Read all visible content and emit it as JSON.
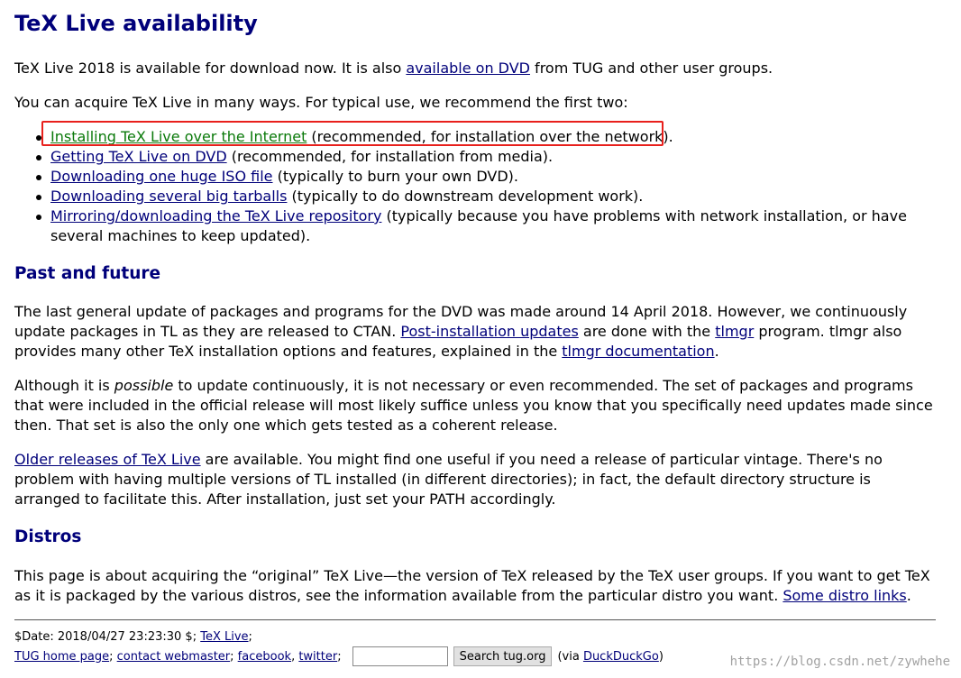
{
  "title": "TeX Live availability",
  "intro": {
    "text_before": "TeX Live 2018 is available for download now. It is also ",
    "dvd_link": "available on DVD",
    "text_after": " from TUG and other user groups."
  },
  "acquire_text": "You can acquire TeX Live in many ways. For typical use, we recommend the first two:",
  "ways": [
    {
      "link": "Installing TeX Live over the Internet",
      "desc": " (recommended, for installation over the network)."
    },
    {
      "link": "Getting TeX Live on DVD",
      "desc": " (recommended, for installation from media)."
    },
    {
      "link": "Downloading one huge ISO file",
      "desc": " (typically to burn your own DVD)."
    },
    {
      "link": "Downloading several big tarballs",
      "desc": " (typically to do downstream development work)."
    },
    {
      "link": "Mirroring/downloading the TeX Live repository",
      "desc": " (typically because you have problems with network installation, or have several machines to keep updated)."
    }
  ],
  "past_future": {
    "heading": "Past and future",
    "p1_a": "The last general update of packages and programs for the DVD was made around 14 April 2018. However, we continuously update packages in TL as they are released to CTAN. ",
    "p1_link1": "Post-installation updates",
    "p1_b": " are done with the ",
    "p1_link2": "tlmgr",
    "p1_c": " program. tlmgr also provides many other TeX installation options and features, explained in the ",
    "p1_link3": "tlmgr documentation",
    "p1_d": ".",
    "p2_a": "Although it is ",
    "p2_em": "possible",
    "p2_b": " to update continuously, it is not necessary or even recommended. The set of packages and programs that were included in the official release will most likely suffice unless you know that you specifically need updates made since then. That set is also the only one which gets tested as a coherent release.",
    "p3_link": "Older releases of TeX Live",
    "p3_text": " are available. You might find one useful if you need a release of particular vintage. There's no problem with having multiple versions of TL installed (in different directories); in fact, the default directory structure is arranged to facilitate this. After installation, just set your PATH accordingly."
  },
  "distros": {
    "heading": "Distros",
    "text": "This page is about acquiring the “original” TeX Live—the version of TeX released by the TeX user groups. If you want to get TeX as it is packaged by the various distros, see the information available from the particular distro you want. ",
    "link": "Some distro links",
    "end": "."
  },
  "footer": {
    "date_text": "$Date: 2018/04/27 23:23:30 $; ",
    "texlive_link": "TeX Live",
    "semicolon": ";",
    "home_link": "TUG home page",
    "contact_link": "contact webmaster",
    "facebook_link": "facebook",
    "twitter_link": "twitter",
    "sep": "; ",
    "comma": ", ",
    "search_value": "",
    "search_button": "Search tug.org",
    "via_text": "(via ",
    "duck_link": "DuckDuckGo",
    "via_end": ")"
  },
  "watermark": "https://blog.csdn.net/zywhehe",
  "colors": {
    "heading": "#00007a",
    "link": "#00007a",
    "visited_link": "#0b7a0b",
    "highlight_border": "#e8201c"
  }
}
